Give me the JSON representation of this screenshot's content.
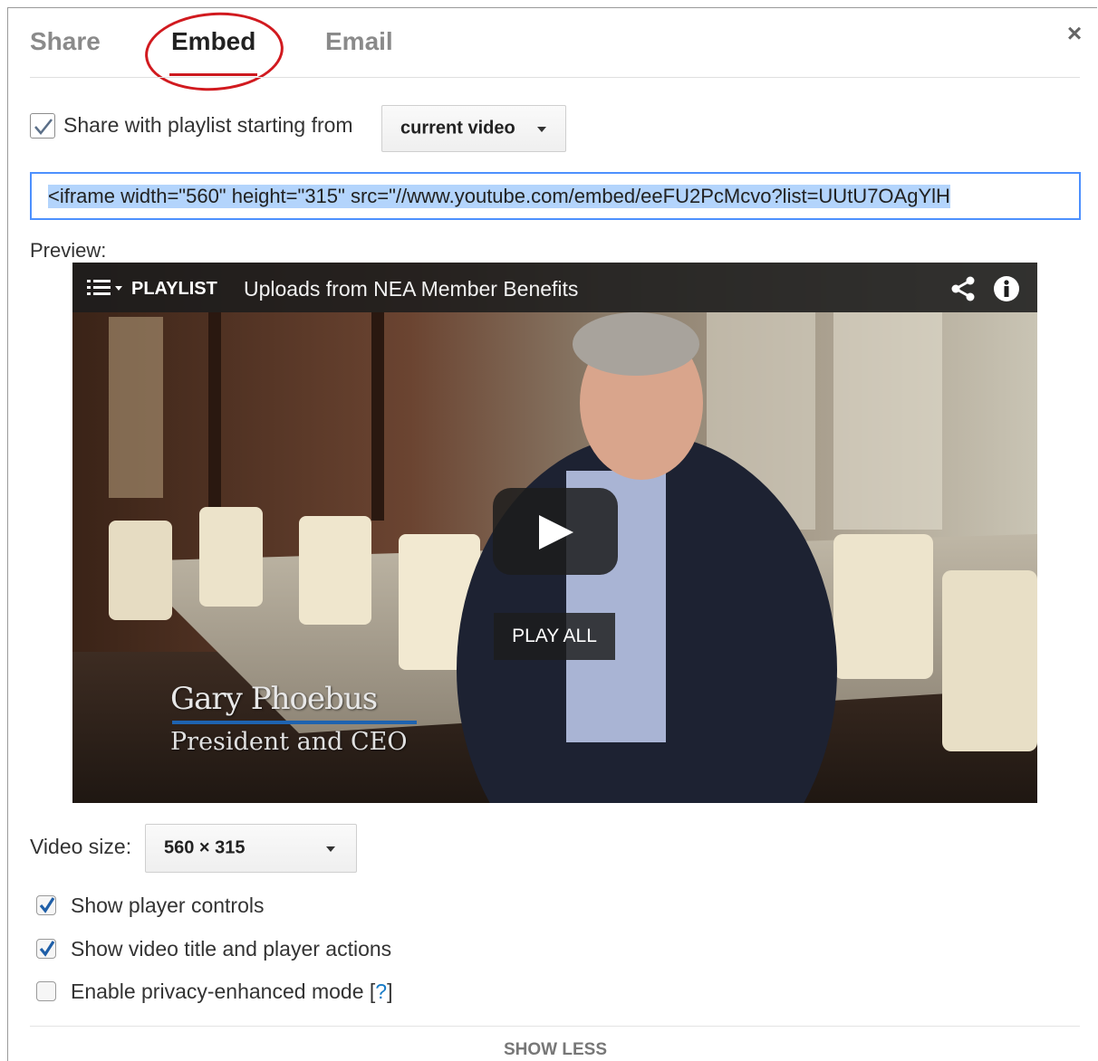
{
  "tabs": {
    "share": "Share",
    "embed": "Embed",
    "email": "Email",
    "active": "Embed"
  },
  "close_glyph": "×",
  "playlist_option": {
    "label": "Share with playlist starting from",
    "checked": true,
    "selected": "current video"
  },
  "embed_code": "<iframe width=\"560\" height=\"315\" src=\"//www.youtube.com/embed/eeFU2PcMcvo?list=UUtU7OAgYlH",
  "preview_label": "Preview:",
  "player": {
    "playlist_tag": "PLAYLIST",
    "playlist_title": "Uploads from NEA Member Benefits",
    "play_all": "PLAY ALL",
    "lower_third_name": "Gary Phoebus",
    "lower_third_title": "President and CEO",
    "icons": [
      "playlist-menu-icon",
      "share-icon",
      "info-icon",
      "play-icon"
    ]
  },
  "video_size": {
    "label": "Video size:",
    "selected": "560 × 315"
  },
  "options": [
    {
      "label": "Show player controls",
      "checked": true
    },
    {
      "label": "Show video title and player actions",
      "checked": true
    },
    {
      "label": "Enable privacy-enhanced mode",
      "help": "?",
      "checked": false
    }
  ],
  "show_less": "SHOW LESS",
  "colors": {
    "accent_red": "#cc181e",
    "focus_blue": "#4d90fe",
    "selection_blue": "#b3d4fc",
    "link_blue": "#167ac6",
    "checkmark_blue": "#1f5fa8"
  }
}
